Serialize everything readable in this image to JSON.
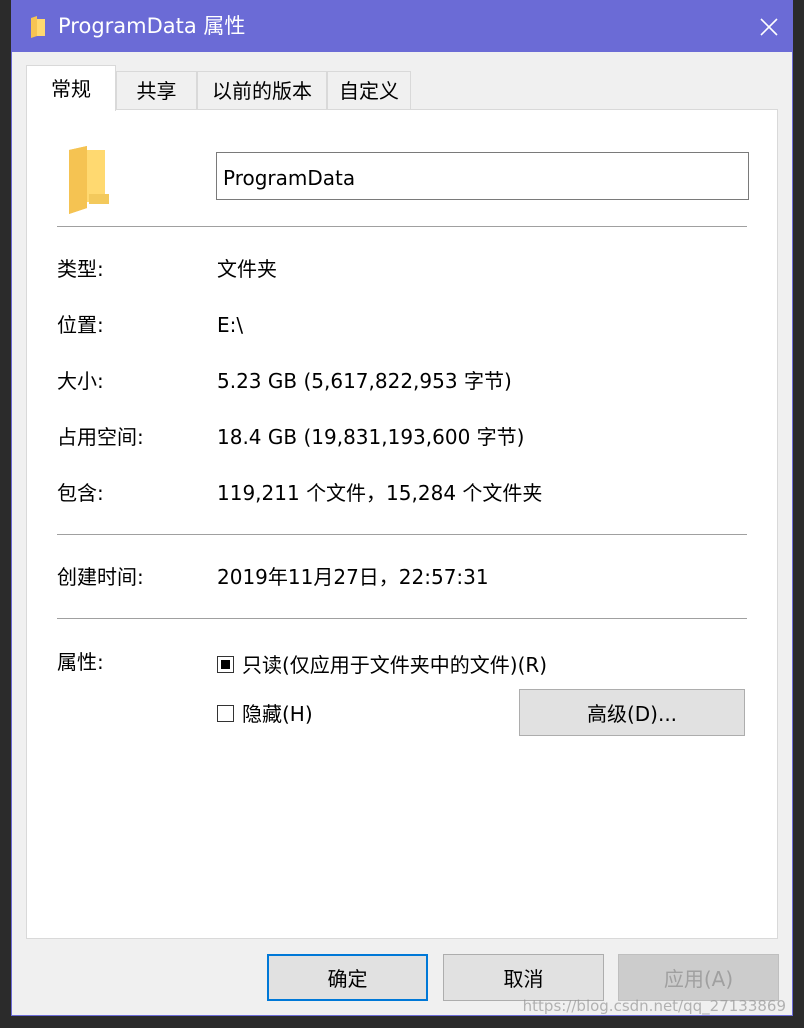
{
  "window": {
    "title": "ProgramData 属性",
    "close_symbol": "✕",
    "title_icon": "folder-icon",
    "accent_color": "#6b6bd6"
  },
  "tabs": [
    {
      "label": "常规",
      "active": true
    },
    {
      "label": "共享",
      "active": false
    },
    {
      "label": "以前的版本",
      "active": false
    },
    {
      "label": "自定义",
      "active": false
    }
  ],
  "general": {
    "folder_name": "ProgramData",
    "type_label": "类型:",
    "type_value": "文件夹",
    "location_label": "位置:",
    "location_value": "E:\\",
    "size_label": "大小:",
    "size_value": "5.23 GB (5,617,822,953 字节)",
    "disk_size_label": "占用空间:",
    "disk_size_value": "18.4 GB (19,831,193,600 字节)",
    "contains_label": "包含:",
    "contains_value": "119,211 个文件，15,284 个文件夹",
    "created_label": "创建时间:",
    "created_value": "2019年11月27日，22:57:31",
    "attributes_label": "属性:",
    "readonly_label": "只读(仅应用于文件夹中的文件)(R)",
    "readonly_checked": true,
    "hidden_label": "隐藏(H)",
    "hidden_checked": false,
    "advanced_button": "高级(D)..."
  },
  "footer": {
    "ok_button": "确定",
    "cancel_button": "取消",
    "apply_button": "应用(A)",
    "watermark": "https://blog.csdn.net/qq_27133869"
  }
}
